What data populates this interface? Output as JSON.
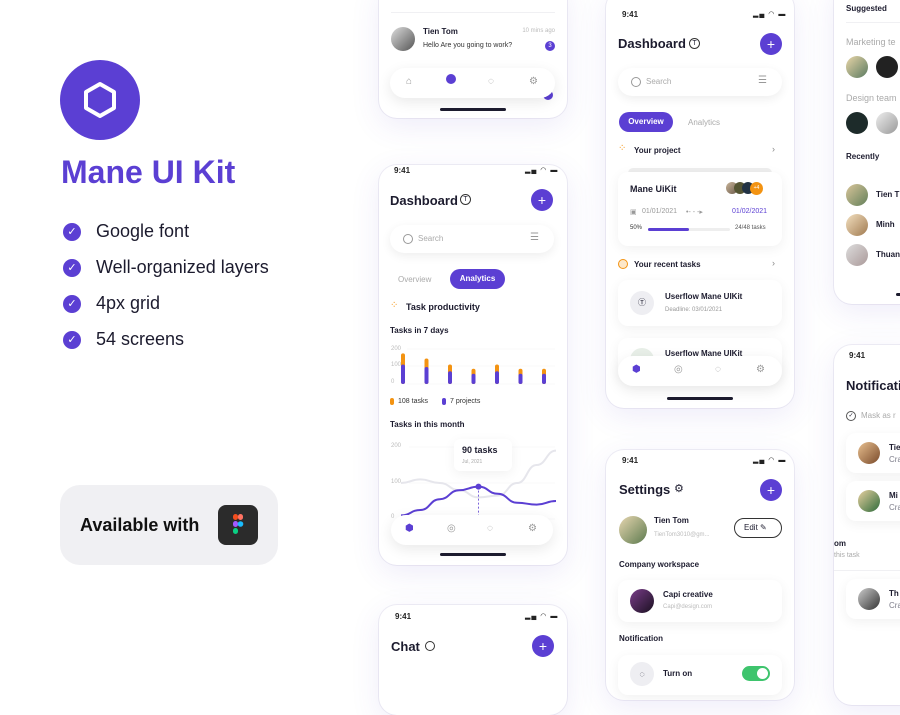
{
  "brand": {
    "title": "Mane UI Kit",
    "accent": "#5b3fd3",
    "logo_icon": "hexagon-icon"
  },
  "features": [
    "Google font",
    "Well-organized layers",
    "4px grid",
    "54 screens"
  ],
  "badge": {
    "label": "Available with",
    "icon": "figma-icon"
  },
  "status": {
    "time": "9:41",
    "icons": "signal wifi battery"
  },
  "chat_top": {
    "name": "Tien Tom",
    "time": "10 mins ago",
    "message": "Hello Are you going to work?",
    "unread": "3"
  },
  "dashboard_analytics": {
    "title": "Dashboard",
    "search_placeholder": "Search",
    "tabs": [
      "Overview",
      "Analytics"
    ],
    "active_tab": "Analytics",
    "section": "Task productivity",
    "chart_7days": {
      "title": "Tasks in 7 days",
      "y_ticks": [
        "200",
        "100",
        "0"
      ],
      "ylim": [
        0,
        200
      ],
      "series": [
        {
          "name": "108 tasks",
          "color": "#f39312",
          "values": [
            180,
            150,
            115,
            90,
            115,
            90,
            90
          ]
        },
        {
          "name": "7 projects",
          "color": "#5b3fd3",
          "values": [
            115,
            100,
            75,
            60,
            75,
            60,
            60
          ]
        }
      ]
    },
    "chart_month": {
      "title": "Tasks in this month",
      "y_ticks": [
        "200",
        "100",
        "0"
      ],
      "ylim": [
        0,
        200
      ],
      "series": [
        {
          "color": "#5b3fd3",
          "values": [
            10,
            25,
            55,
            80,
            90,
            70,
            45,
            40,
            50
          ]
        },
        {
          "color": "#e6e6ec",
          "values": [
            100,
            110,
            100,
            80,
            60,
            65,
            100,
            150,
            190
          ]
        }
      ],
      "tooltip": {
        "value": "90 tasks",
        "date": "Jul, 2021"
      }
    }
  },
  "dashboard_overview": {
    "title": "Dashboard",
    "search_placeholder": "Search",
    "tabs": [
      "Overview",
      "Analytics"
    ],
    "active_tab": "Overview",
    "project_section": "Your project",
    "project": {
      "name": "Mane UiKit",
      "extra_members": "+4",
      "start": "01/01/2021",
      "end": "01/02/2021",
      "progress_label": "50%",
      "progress": 50,
      "tasks": "24/48 tasks"
    },
    "recent_section": "Your recent tasks",
    "tasks": [
      {
        "name": "Userflow Mane UIKit",
        "deadline": "Deadline: 03/01/2021"
      },
      {
        "name": "Userflow Mane UIKit"
      }
    ]
  },
  "chat": {
    "title": "Chat"
  },
  "settings": {
    "title": "Settings",
    "name": "Tien Tom",
    "email": "TienTom3010@gm...",
    "edit": "Edit",
    "workspace_section": "Company workspace",
    "workspace": {
      "name": "Capi creative",
      "email": "Capi@design.com"
    },
    "notification_section": "Notification",
    "notification_toggle": "Turn on",
    "toggle_on": true,
    "toggle_color": "#3ec46d"
  },
  "people": {
    "suggested": "Suggested",
    "marketing": "Marketing te",
    "design": "Design team",
    "recently": "Recently",
    "recent": [
      "Tien T",
      "Minh",
      "Thuan"
    ]
  },
  "notifications": {
    "title": "Notificati",
    "mark": "Mask as r",
    "items": [
      {
        "name": "Tie",
        "sub": "Cra"
      },
      {
        "name": "Mi",
        "sub": "Cra"
      },
      {
        "name": "Th",
        "sub": "Cra"
      }
    ],
    "overflow_name": "om",
    "overflow_sub": "this task"
  }
}
